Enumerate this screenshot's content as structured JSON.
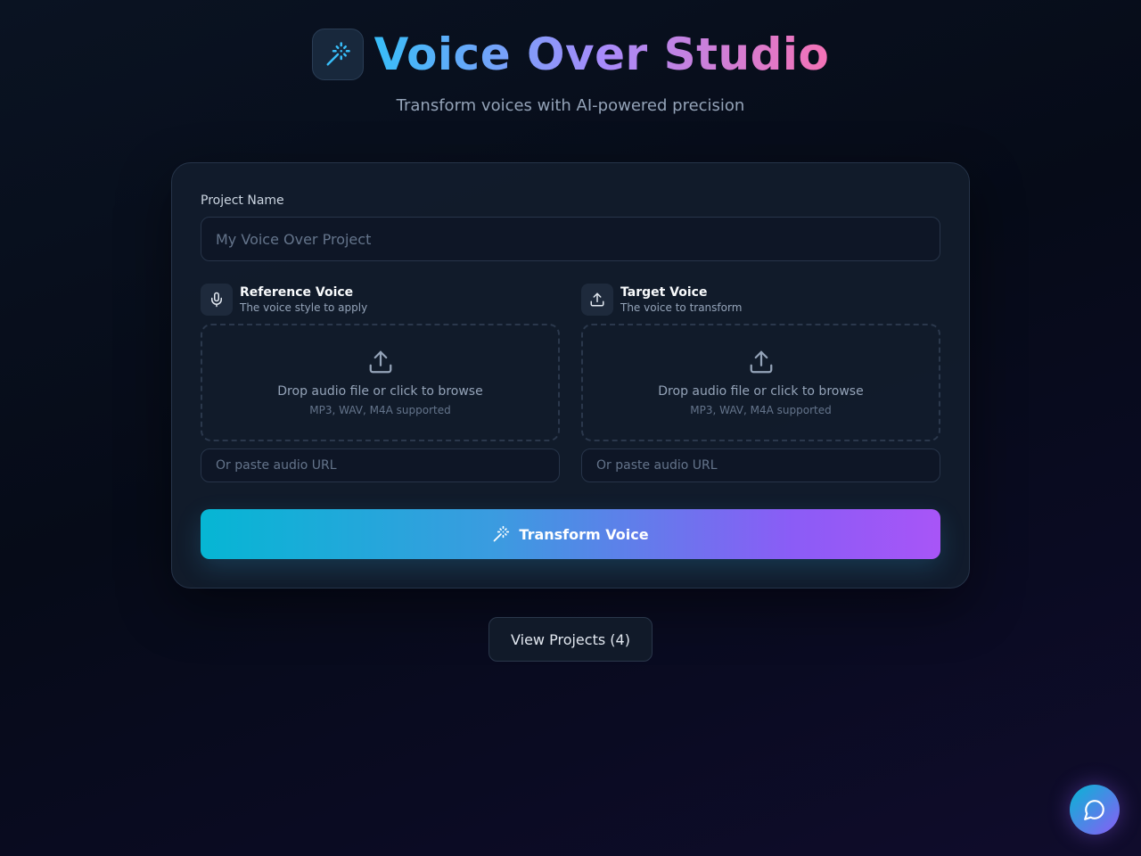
{
  "app": {
    "title": "Voice Over Studio",
    "subtitle": "Transform voices with AI-powered precision",
    "logo_icon": "magic-wand-icon"
  },
  "form": {
    "project_label": "Project Name",
    "project_placeholder": "My Voice Over Project",
    "project_value": "",
    "reference": {
      "icon": "microphone-icon",
      "title": "Reference Voice",
      "description": "The voice style to apply",
      "drop_icon": "upload-icon",
      "drop_text": "Drop audio file or click to browse",
      "drop_sub": "MP3, WAV, M4A supported",
      "url_placeholder": "Or paste audio URL"
    },
    "target": {
      "icon": "upload-icon",
      "title": "Target Voice",
      "description": "The voice to transform",
      "drop_icon": "upload-icon",
      "drop_text": "Drop audio file or click to browse",
      "drop_sub": "MP3, WAV, M4A supported",
      "url_placeholder": "Or paste audio URL"
    },
    "submit_label": "Transform Voice",
    "submit_icon": "magic-wand-icon"
  },
  "projects": {
    "button_label": "View Projects (4)"
  },
  "chat": {
    "icon": "chat-bubble-icon"
  },
  "colors": {
    "accent_cyan": "#06b6d4",
    "accent_purple": "#a855f7",
    "title_pink": "#f472b6",
    "background": "#060b18"
  }
}
